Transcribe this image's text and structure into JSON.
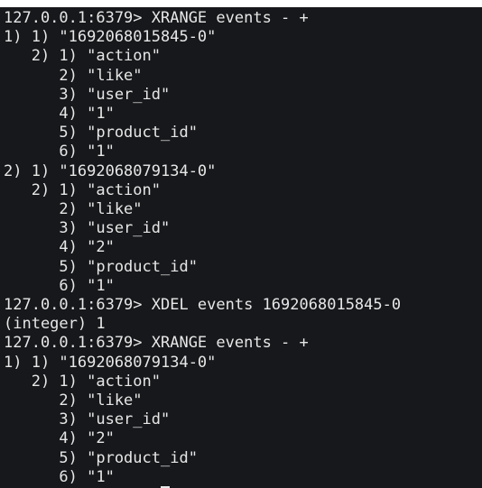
{
  "terminal": {
    "lines": [
      "127.0.0.1:6379> XRANGE events - +",
      "1) 1) \"1692068015845-0\"",
      "   2) 1) \"action\"",
      "      2) \"like\"",
      "      3) \"user_id\"",
      "      4) \"1\"",
      "      5) \"product_id\"",
      "      6) \"1\"",
      "2) 1) \"1692068079134-0\"",
      "   2) 1) \"action\"",
      "      2) \"like\"",
      "      3) \"user_id\"",
      "      4) \"2\"",
      "      5) \"product_id\"",
      "      6) \"1\"",
      "127.0.0.1:6379> XDEL events 1692068015845-0",
      "(integer) 1",
      "127.0.0.1:6379> XRANGE events - +",
      "1) 1) \"1692068079134-0\"",
      "   2) 1) \"action\"",
      "      2) \"like\"",
      "      3) \"user_id\"",
      "      4) \"2\"",
      "      5) \"product_id\"",
      "      6) \"1\""
    ]
  },
  "colors": {
    "background": "#17181b",
    "text": "#e7e7e7"
  }
}
